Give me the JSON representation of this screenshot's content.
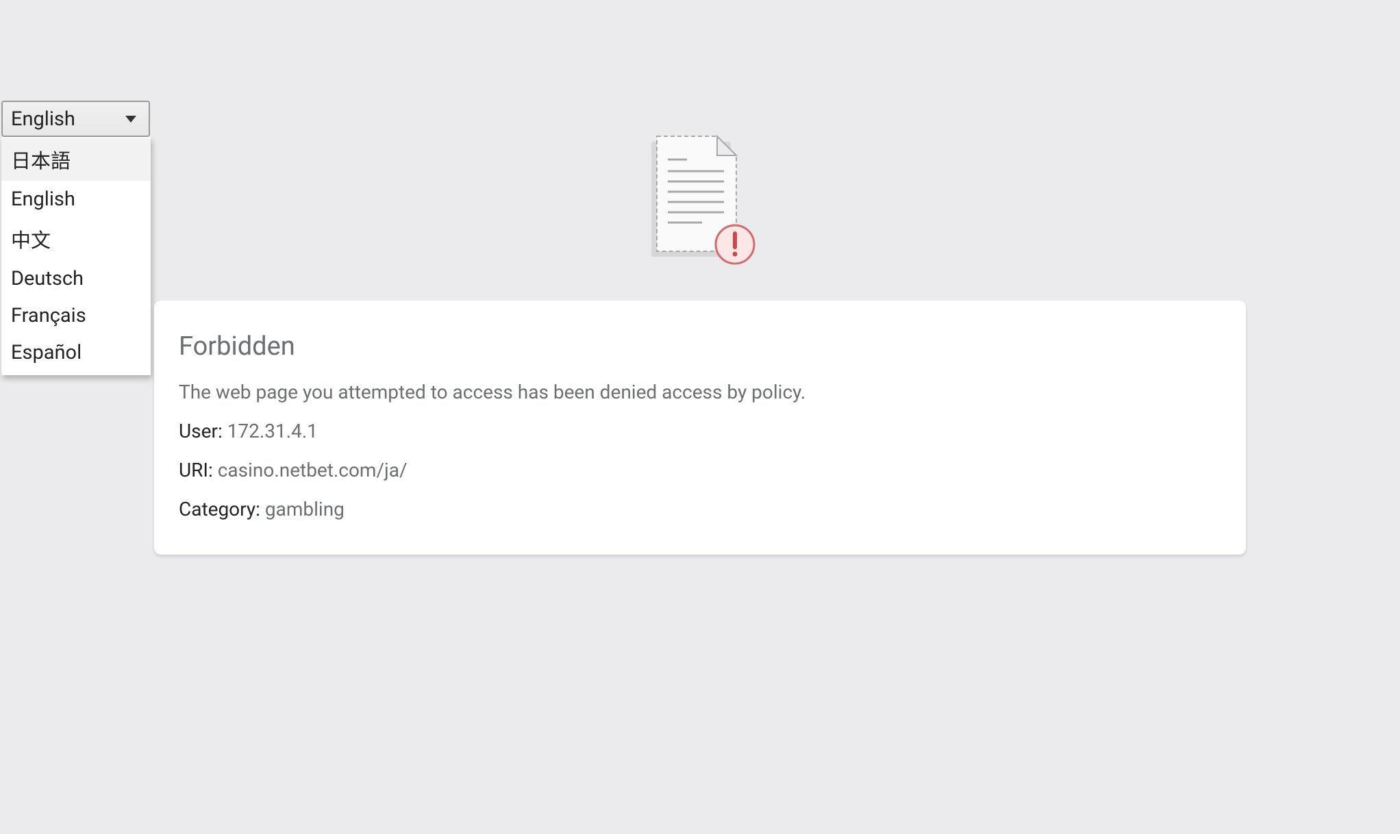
{
  "language_selector": {
    "selected": "English",
    "options": [
      "日本語",
      "English",
      "中文",
      "Deutsch",
      "Français",
      "Español"
    ]
  },
  "card": {
    "title": "Forbidden",
    "message": "The web page you attempted to access has been denied access by policy.",
    "user_label": "User:",
    "user_value": "172.31.4.1",
    "uri_label": "URI:",
    "uri_value": "casino.netbet.com/ja/",
    "category_label": "Category:",
    "category_value": "gambling"
  }
}
